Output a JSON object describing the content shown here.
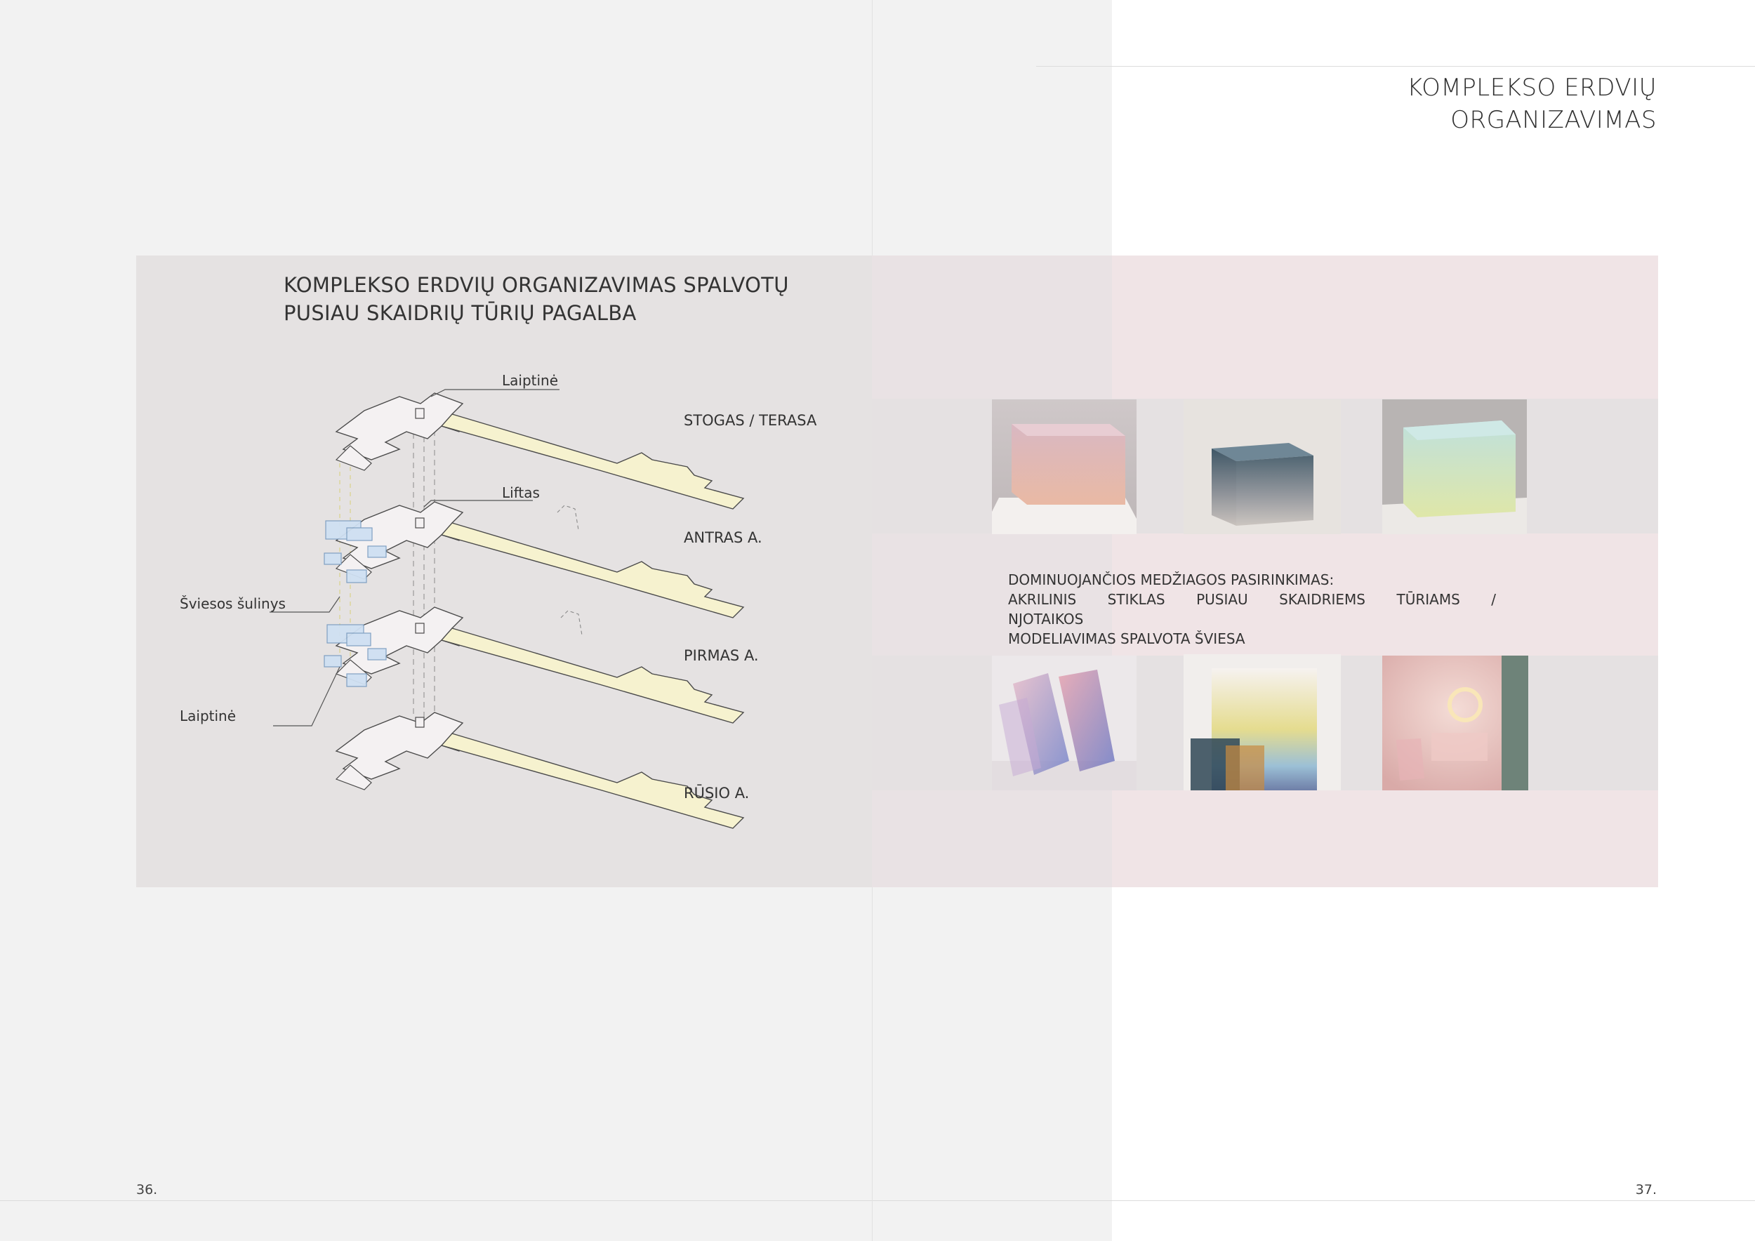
{
  "page_title": [
    "KOMPLEKSO ERDVIŲ",
    "ORGANIZAVIMAS"
  ],
  "diagram": {
    "title": [
      "KOMPLEKSO ERDVIŲ ORGANIZAVIMAS SPALVOTŲ",
      "PUSIAU SKAIDRIŲ TŪRIŲ PAGALBA"
    ],
    "floors": [
      "STOGAS / TERASA",
      "ANTRAS A.",
      "PIRMAS A.",
      "RŪSIO A."
    ],
    "callouts": {
      "stair_top": "Laiptinė",
      "elevator": "Liftas",
      "light_well": "Šviesos šulinys",
      "stair_bottom": "Laiptinė"
    }
  },
  "materials": {
    "heading": "DOMINUOJANČIOS MEDŽIAGOS PASIRINKIMAS:",
    "line2": "AKRILINIS STIKLAS PUSIAU SKAIDRIEMS TŪRIAMS / NJOTAIKOS",
    "line3": "MODELIAVIMAS SPALVOTA ŠVIESA"
  },
  "page_numbers": {
    "left": "36.",
    "right": "37."
  },
  "colors": {
    "left_page_bg": "#f2f2f2",
    "left_panel": "#e5e2e2",
    "right_panel": "#f0e4e6",
    "floor_fill": "#f4f1f2",
    "corridor_yellow": "#f6f2cf",
    "blue_volume": "#cfe0f2"
  }
}
